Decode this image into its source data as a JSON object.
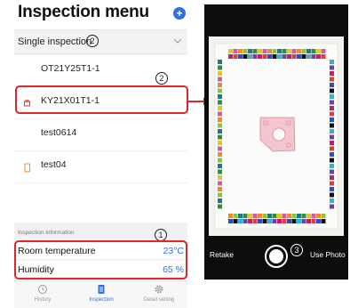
{
  "app": {
    "title": "Inspection menu",
    "add_icon": "plus-icon",
    "add_symbol": "+"
  },
  "mode": {
    "label": "Single inspection",
    "dropdown_icon": "chevron-down-icon"
  },
  "list_items": [
    {
      "label": "OT21Y25T1-1",
      "icon": ""
    },
    {
      "label": "KY21X01T1-1",
      "icon": "small-red-icon"
    },
    {
      "label": "test0614",
      "icon": ""
    },
    {
      "label": "test04",
      "icon": "phone-icon"
    }
  ],
  "info": {
    "header": "Inspection information",
    "temperature_label": "Room temperature",
    "temperature_value": "23°C",
    "humidity_label": "Humidity",
    "humidity_value": "65 %"
  },
  "tabs": [
    {
      "label": "History",
      "icon": "clock-icon",
      "active": false
    },
    {
      "label": "Inspection",
      "icon": "document-icon",
      "active": true
    },
    {
      "label": "Detail setting",
      "icon": "gear-icon",
      "active": false
    }
  ],
  "annotations": {
    "num1": "1",
    "num2": "2",
    "num3": "3"
  },
  "camera": {
    "retake_label": "Retake",
    "use_photo_label": "Use Photo"
  },
  "colors": {
    "accent": "#2f6fe6",
    "highlight": "#e0262b"
  }
}
